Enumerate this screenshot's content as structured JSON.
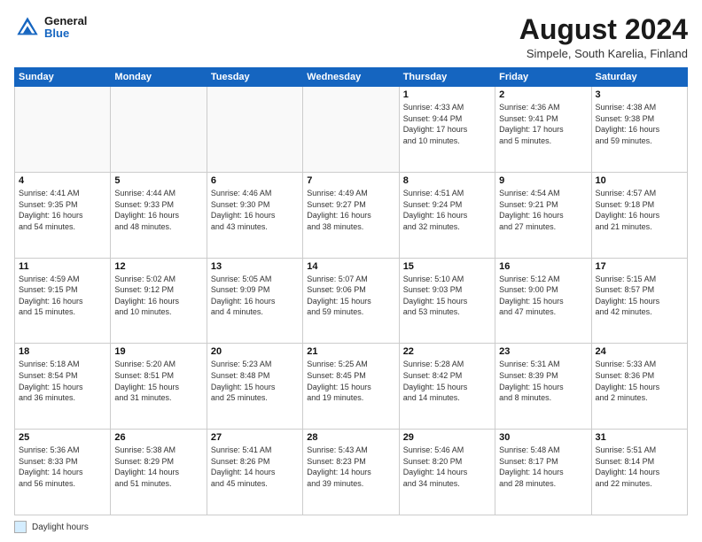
{
  "header": {
    "logo_general": "General",
    "logo_blue": "Blue",
    "month_year": "August 2024",
    "location": "Simpele, South Karelia, Finland"
  },
  "legend": {
    "box_label": "Daylight hours"
  },
  "days_of_week": [
    "Sunday",
    "Monday",
    "Tuesday",
    "Wednesday",
    "Thursday",
    "Friday",
    "Saturday"
  ],
  "weeks": [
    [
      {
        "num": "",
        "info": ""
      },
      {
        "num": "",
        "info": ""
      },
      {
        "num": "",
        "info": ""
      },
      {
        "num": "",
        "info": ""
      },
      {
        "num": "1",
        "info": "Sunrise: 4:33 AM\nSunset: 9:44 PM\nDaylight: 17 hours\nand 10 minutes."
      },
      {
        "num": "2",
        "info": "Sunrise: 4:36 AM\nSunset: 9:41 PM\nDaylight: 17 hours\nand 5 minutes."
      },
      {
        "num": "3",
        "info": "Sunrise: 4:38 AM\nSunset: 9:38 PM\nDaylight: 16 hours\nand 59 minutes."
      }
    ],
    [
      {
        "num": "4",
        "info": "Sunrise: 4:41 AM\nSunset: 9:35 PM\nDaylight: 16 hours\nand 54 minutes."
      },
      {
        "num": "5",
        "info": "Sunrise: 4:44 AM\nSunset: 9:33 PM\nDaylight: 16 hours\nand 48 minutes."
      },
      {
        "num": "6",
        "info": "Sunrise: 4:46 AM\nSunset: 9:30 PM\nDaylight: 16 hours\nand 43 minutes."
      },
      {
        "num": "7",
        "info": "Sunrise: 4:49 AM\nSunset: 9:27 PM\nDaylight: 16 hours\nand 38 minutes."
      },
      {
        "num": "8",
        "info": "Sunrise: 4:51 AM\nSunset: 9:24 PM\nDaylight: 16 hours\nand 32 minutes."
      },
      {
        "num": "9",
        "info": "Sunrise: 4:54 AM\nSunset: 9:21 PM\nDaylight: 16 hours\nand 27 minutes."
      },
      {
        "num": "10",
        "info": "Sunrise: 4:57 AM\nSunset: 9:18 PM\nDaylight: 16 hours\nand 21 minutes."
      }
    ],
    [
      {
        "num": "11",
        "info": "Sunrise: 4:59 AM\nSunset: 9:15 PM\nDaylight: 16 hours\nand 15 minutes."
      },
      {
        "num": "12",
        "info": "Sunrise: 5:02 AM\nSunset: 9:12 PM\nDaylight: 16 hours\nand 10 minutes."
      },
      {
        "num": "13",
        "info": "Sunrise: 5:05 AM\nSunset: 9:09 PM\nDaylight: 16 hours\nand 4 minutes."
      },
      {
        "num": "14",
        "info": "Sunrise: 5:07 AM\nSunset: 9:06 PM\nDaylight: 15 hours\nand 59 minutes."
      },
      {
        "num": "15",
        "info": "Sunrise: 5:10 AM\nSunset: 9:03 PM\nDaylight: 15 hours\nand 53 minutes."
      },
      {
        "num": "16",
        "info": "Sunrise: 5:12 AM\nSunset: 9:00 PM\nDaylight: 15 hours\nand 47 minutes."
      },
      {
        "num": "17",
        "info": "Sunrise: 5:15 AM\nSunset: 8:57 PM\nDaylight: 15 hours\nand 42 minutes."
      }
    ],
    [
      {
        "num": "18",
        "info": "Sunrise: 5:18 AM\nSunset: 8:54 PM\nDaylight: 15 hours\nand 36 minutes."
      },
      {
        "num": "19",
        "info": "Sunrise: 5:20 AM\nSunset: 8:51 PM\nDaylight: 15 hours\nand 31 minutes."
      },
      {
        "num": "20",
        "info": "Sunrise: 5:23 AM\nSunset: 8:48 PM\nDaylight: 15 hours\nand 25 minutes."
      },
      {
        "num": "21",
        "info": "Sunrise: 5:25 AM\nSunset: 8:45 PM\nDaylight: 15 hours\nand 19 minutes."
      },
      {
        "num": "22",
        "info": "Sunrise: 5:28 AM\nSunset: 8:42 PM\nDaylight: 15 hours\nand 14 minutes."
      },
      {
        "num": "23",
        "info": "Sunrise: 5:31 AM\nSunset: 8:39 PM\nDaylight: 15 hours\nand 8 minutes."
      },
      {
        "num": "24",
        "info": "Sunrise: 5:33 AM\nSunset: 8:36 PM\nDaylight: 15 hours\nand 2 minutes."
      }
    ],
    [
      {
        "num": "25",
        "info": "Sunrise: 5:36 AM\nSunset: 8:33 PM\nDaylight: 14 hours\nand 56 minutes."
      },
      {
        "num": "26",
        "info": "Sunrise: 5:38 AM\nSunset: 8:29 PM\nDaylight: 14 hours\nand 51 minutes."
      },
      {
        "num": "27",
        "info": "Sunrise: 5:41 AM\nSunset: 8:26 PM\nDaylight: 14 hours\nand 45 minutes."
      },
      {
        "num": "28",
        "info": "Sunrise: 5:43 AM\nSunset: 8:23 PM\nDaylight: 14 hours\nand 39 minutes."
      },
      {
        "num": "29",
        "info": "Sunrise: 5:46 AM\nSunset: 8:20 PM\nDaylight: 14 hours\nand 34 minutes."
      },
      {
        "num": "30",
        "info": "Sunrise: 5:48 AM\nSunset: 8:17 PM\nDaylight: 14 hours\nand 28 minutes."
      },
      {
        "num": "31",
        "info": "Sunrise: 5:51 AM\nSunset: 8:14 PM\nDaylight: 14 hours\nand 22 minutes."
      }
    ]
  ]
}
